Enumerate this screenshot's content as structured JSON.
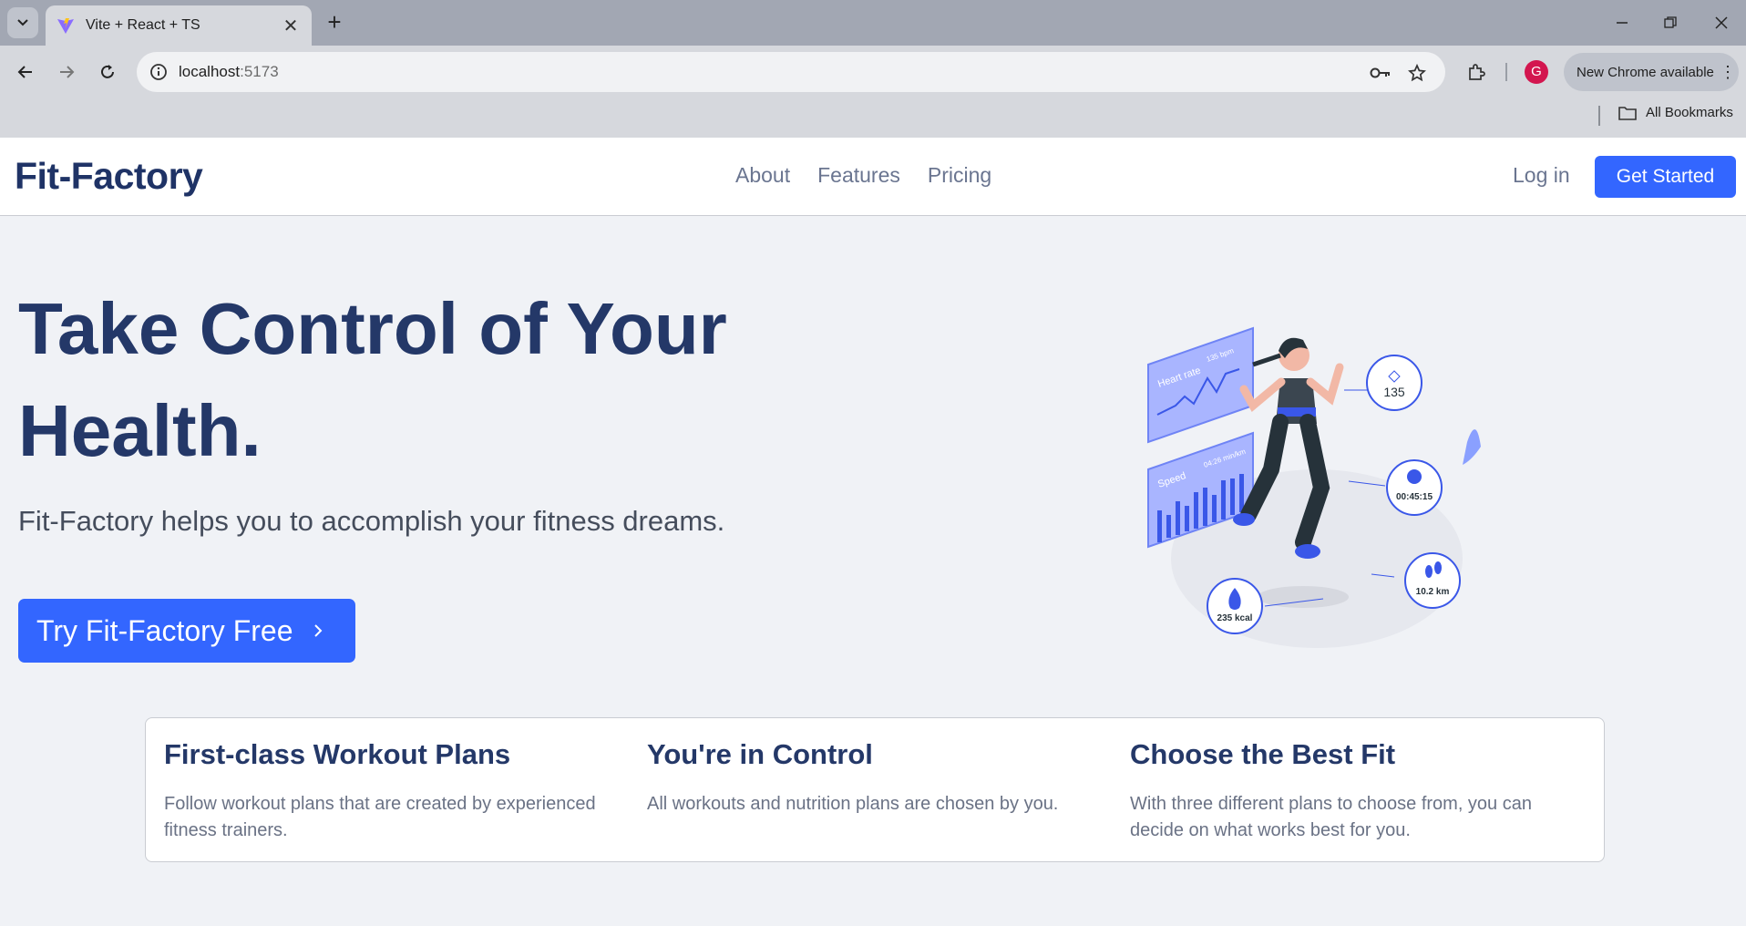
{
  "browser": {
    "tab_title": "Vite + React + TS",
    "url_host": "localhost",
    "url_port": ":5173",
    "profile_initial": "G",
    "update_label": "New Chrome available",
    "bookmarks_label": "All Bookmarks",
    "icons": [
      "tab-search-icon",
      "vite-favicon",
      "close-icon",
      "plus-icon",
      "minimize-icon",
      "restore-icon",
      "close-window-icon",
      "back-arrow-icon",
      "forward-arrow-icon",
      "reload-icon",
      "site-info-icon",
      "password-key-icon",
      "star-icon",
      "extensions-icon",
      "more-vert-icon",
      "folder-icon"
    ]
  },
  "nav": {
    "brand": "Fit-Factory",
    "links": [
      "About",
      "Features",
      "Pricing"
    ],
    "login": "Log in",
    "cta": "Get Started"
  },
  "hero": {
    "title": "Take Control of Your Health.",
    "subtitle": "Fit-Factory helps you to accomplish your fitness dreams.",
    "cta": "Try Fit-Factory Free",
    "illustration": {
      "heart_panel": "Heart rate",
      "heart_value": "135 bpm",
      "speed_panel": "Speed",
      "speed_value": "04:26 min/km",
      "bpm": "135",
      "time": "00:45:15",
      "distance": "10.2 km",
      "calories": "235 kcal"
    }
  },
  "features": [
    {
      "title": "First-class Workout Plans",
      "text": "Follow workout plans that are created by experienced fitness trainers."
    },
    {
      "title": "You're in Control",
      "text": "All workouts and nutrition plans are chosen by you."
    },
    {
      "title": "Choose the Best Fit",
      "text": "With three different plans to choose from, you can decide on what works best for you."
    }
  ],
  "colors": {
    "primary": "#3366ff",
    "heading": "#243868",
    "page_bg": "#f0f2f6"
  }
}
